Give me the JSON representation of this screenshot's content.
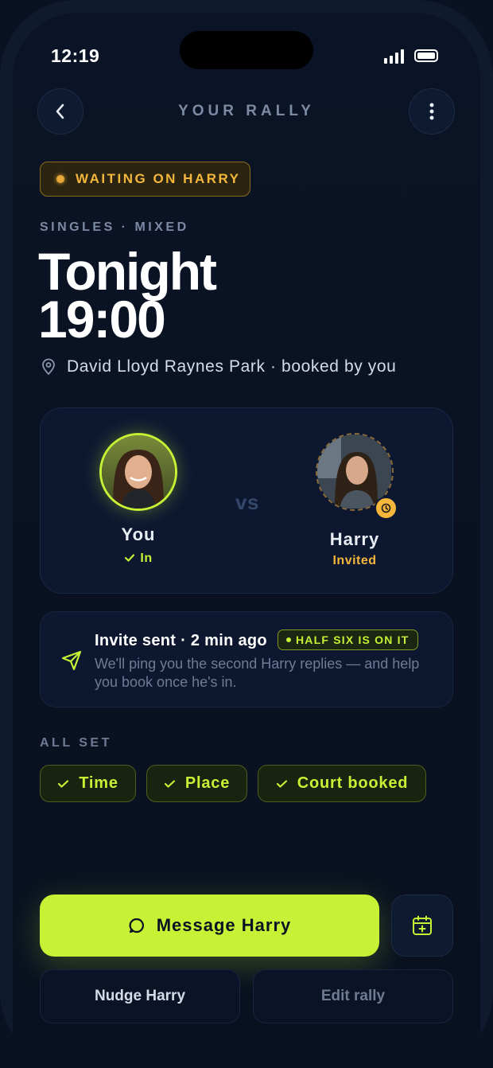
{
  "status_bar": {
    "time": "12:19"
  },
  "header": {
    "title": "YOUR RALLY"
  },
  "status": {
    "label": "WAITING ON HARRY",
    "color": "#f5b73b"
  },
  "match": {
    "kicker": "SINGLES · MIXED",
    "day": "Tonight",
    "time": "19:00",
    "location": "David Lloyd Raynes Park · booked by you"
  },
  "players": {
    "you": {
      "name": "You",
      "status": "In"
    },
    "versus": "vs",
    "opponent": {
      "name": "Harry",
      "status": "Invited"
    }
  },
  "invite": {
    "title": "Invite sent · 2 min ago",
    "badge": "HALF SIX IS ON IT",
    "description": "We'll ping you the second Harry replies — and help you book once he's in."
  },
  "checklist": {
    "label": "ALL SET",
    "items": [
      "Time",
      "Place",
      "Court booked"
    ]
  },
  "actions": {
    "primary": "Message Harry",
    "nudge": "Nudge Harry",
    "edit": "Edit rally"
  },
  "colors": {
    "accent": "#c6f135",
    "warning": "#f5b73b",
    "background": "#0a1122"
  }
}
